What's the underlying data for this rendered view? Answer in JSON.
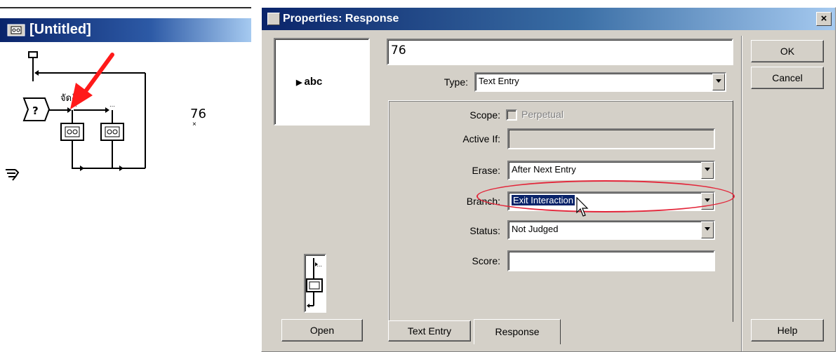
{
  "flow_window": {
    "title": "[Untitled]",
    "thai_label": "จัดงัด",
    "value_label": "76",
    "marker": "×"
  },
  "dialog": {
    "title": "Properties: Response",
    "close_glyph": "×",
    "preview_text": "abc",
    "response_title": "76",
    "open_label": "Open",
    "ok_label": "OK",
    "cancel_label": "Cancel",
    "help_label": "Help",
    "type": {
      "label": "Type:",
      "value": "Text Entry"
    },
    "scope": {
      "label": "Scope:",
      "option": "Perpetual",
      "checked": false
    },
    "active_if": {
      "label": "Active If:",
      "value": ""
    },
    "erase": {
      "label": "Erase:",
      "value": "After Next Entry"
    },
    "branch": {
      "label": "Branch:",
      "value": "Exit Interaction"
    },
    "status": {
      "label": "Status:",
      "value": "Not Judged"
    },
    "score": {
      "label": "Score:",
      "value": ""
    },
    "tabs": [
      {
        "label": "Text Entry",
        "active": false
      },
      {
        "label": "Response",
        "active": true
      }
    ]
  },
  "colors": {
    "titlebar": "#0a246a",
    "face": "#d4d0c8",
    "highlight_ellipse": "#e3263a",
    "annotation_arrow": "#ff1a1a"
  }
}
